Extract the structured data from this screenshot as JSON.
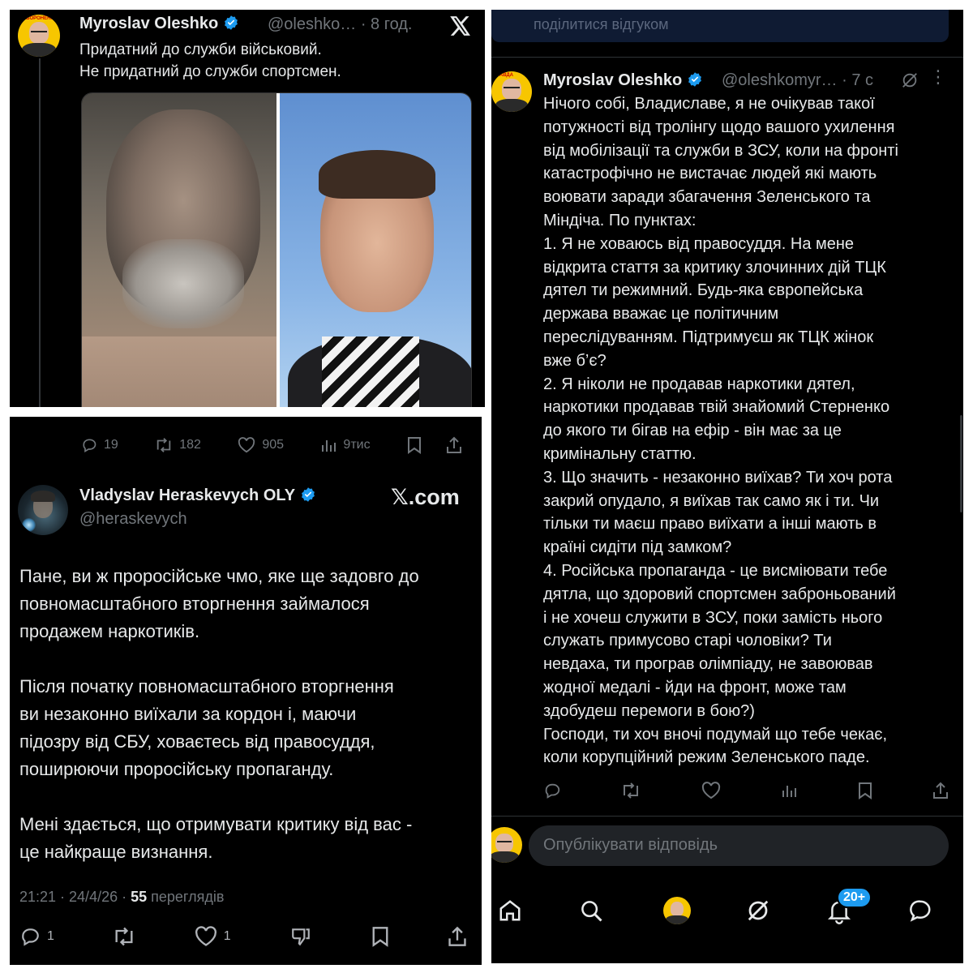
{
  "post1": {
    "author": "Myroslav Oleshko",
    "handle": "@oleshko…",
    "sep": "·",
    "time": "8 год.",
    "lines": [
      "Придатний до служби військовий.",
      "Не придатний до служби спортсмен."
    ],
    "stats": {
      "replies": "19",
      "reposts": "182",
      "likes": "905",
      "views": "9тис"
    }
  },
  "post2": {
    "author": "Vladyslav Heraskevych OLY",
    "handle": "@heraskevych",
    "brand": "𝕏.com",
    "paragraphs": [
      [
        "Пане, ви ж проросійське чмо, яке ще задовго до",
        "повномасштабного вторгнення займалося",
        "продажем наркотиків."
      ],
      [
        "Після початку повномасштабного вторгнення",
        "ви незаконно виїхали за кордон і, маючи",
        "підозру від СБУ, ховаєтесь від правосуддя,",
        "поширюючи проросійську пропаганду."
      ],
      [
        "Мені здається, що отримувати критику від вас -",
        "це найкраще визнання."
      ]
    ],
    "meta_time": "21:21 · 24/4/26 ·",
    "meta_views_count": "55",
    "meta_views_label": "переглядів",
    "stats": {
      "replies": "1",
      "likes": "1"
    }
  },
  "post3": {
    "top_banner": "поділитися відгуком",
    "author": "Myroslav Oleshko",
    "handle": "@oleshkomyr…",
    "sep": "·",
    "time": "7 с",
    "lines": [
      "Нічого собі, Владиславе, я не очікував такої",
      "потужності від тролінгу щодо вашого ухилення",
      "від мобілізації та служби в ЗСУ, коли на фронті",
      "катастрофічно не вистачає людей які мають",
      "воювати заради збагачення Зеленського та",
      "Міндіча. По пунктах:",
      "1. Я не ховаюсь від правосуддя. На мене",
      "відкрита стаття за критику злочинних дій ТЦК",
      "дятел ти режимний. Будь-яка європейська",
      "держава вважає це політичним",
      "переслідуванням. Підтримуєш як ТЦК жінок",
      "вже б’є?",
      "2. Я ніколи не продавав наркотики дятел,",
      "наркотики продавав твій знайомий Стерненко",
      "до якого ти бігав на ефір - він має за це",
      "кримінальну статтю.",
      "3. Що значить - незаконно виїхав? Ти хоч рота",
      "закрий опудало, я виїхав так само як і ти. Чи",
      "тільки ти маєш право виїхати а інші мають в",
      "країні сидіти під замком?",
      "4. Російська пропаганда - це висміювати тебе",
      "дятла, що здоровий спортсмен заброньований",
      "і не хочеш служити в ЗСУ, поки замість нього",
      "служать примусово старі чоловіки? Ти",
      "невдаха, ти програв олімпіаду, не завоював",
      "жодної медалі - йди на фронт, може там",
      "здобудеш перемоги в бою?)",
      "Господи, ти хоч вночі подумай що тебе чекає,",
      "коли корупційний режим Зеленського паде."
    ],
    "reply_placeholder": "Опублікувати відповідь",
    "notif_badge": "20+"
  },
  "avatar_logo": {
    "line1": "ЗАБОРОНЕНА",
    "line2": "ПРАВДА"
  },
  "colors": {
    "bg": "#000000",
    "text": "#e7e9ea",
    "muted": "#71767b",
    "verified": "#1d9bf0",
    "badge": "#1d9bf0"
  }
}
